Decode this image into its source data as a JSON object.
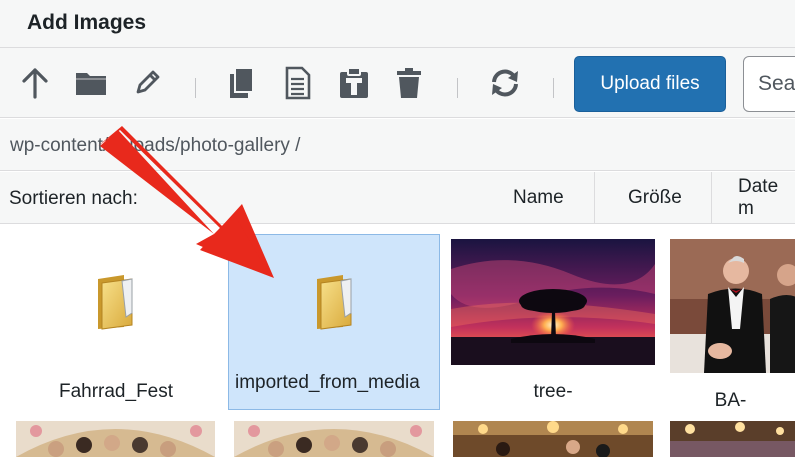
{
  "dialog": {
    "title": "Add Images"
  },
  "toolbar": {
    "icons": [
      "arrow-up-icon",
      "folder-icon",
      "pencil-icon",
      "copy-icon",
      "document-icon",
      "paste-icon",
      "trash-icon",
      "refresh-icon"
    ],
    "upload_label": "Upload files",
    "search_placeholder": "Search"
  },
  "breadcrumb": {
    "path": "wp-content/uploads/photo-gallery /"
  },
  "sort": {
    "label": "Sortieren nach:",
    "columns": [
      "Name",
      "Größe",
      "Date m"
    ]
  },
  "files": [
    {
      "name": "Fahrrad_Fest",
      "kind": "folder",
      "selected": false
    },
    {
      "name": "imported_from_media",
      "kind": "folder",
      "selected": true
    },
    {
      "name": "tree-",
      "kind": "image",
      "selected": false
    },
    {
      "name": "BA-",
      "kind": "image",
      "selected": false
    }
  ],
  "colors": {
    "accent": "#2271b1",
    "selection": "#cfe5fb",
    "annotation_arrow": "#e8291c"
  }
}
